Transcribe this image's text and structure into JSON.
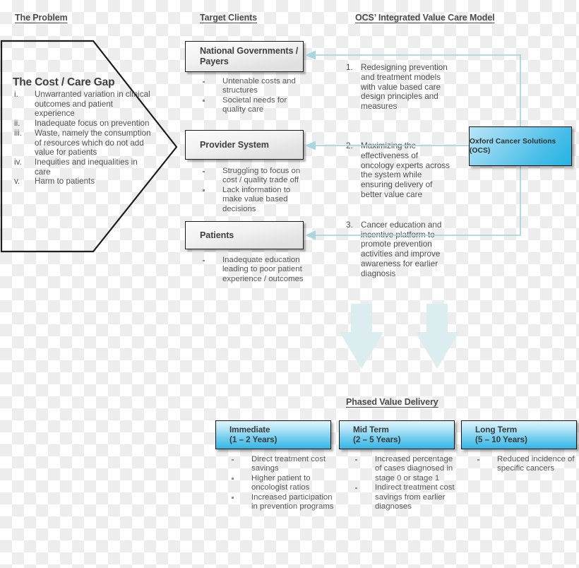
{
  "headers": {
    "problem": "The Problem",
    "target_clients": "Target Clients",
    "ocs_model": "OCS’ Integrated Value Care Model",
    "phased_delivery": "Phased Value Delivery"
  },
  "problem_panel": {
    "title": "The Cost / Care Gap",
    "items": [
      {
        "marker": "i.",
        "text": "Unwarranted variation in clinical outcomes and patient experience"
      },
      {
        "marker": "ii.",
        "text": "Inadequate focus on prevention"
      },
      {
        "marker": "iii.",
        "text": "Waste, namely the consumption of resources which do not add value for patients"
      },
      {
        "marker": "iv.",
        "text": "Inequities and inequalities in care"
      },
      {
        "marker": "v.",
        "text": "Harm to patients"
      }
    ]
  },
  "target_clients": [
    {
      "label": "National Governments / Payers",
      "bullets": [
        "Untenable costs and structures",
        "Societal needs for quality care"
      ]
    },
    {
      "label": "Provider System",
      "bullets": [
        "Struggling to focus on cost / quality trade off",
        "Lack information to make value based decisions"
      ]
    },
    {
      "label": "Patients",
      "bullets": [
        "Inadequate education leading to poor patient experience / outcomes"
      ]
    }
  ],
  "ocs_model": {
    "center_box_label": "Oxford Cancer Solutions (OCS)",
    "points": [
      {
        "marker": "1.",
        "text": "Redesigning prevention and treatment models with value based care design principles and measures"
      },
      {
        "marker": "2.",
        "text": "Maximizing the effectiveness of oncology experts across the system while ensuring delivery of better value care"
      },
      {
        "marker": "3.",
        "text": "Cancer education and incentive platform to promote prevention activities and improve awareness for earlier diagnosis"
      }
    ]
  },
  "phases": [
    {
      "title": "Immediate",
      "period": "(1 – 2 Years)",
      "bullets": [
        "Direct treatment cost savings",
        "Higher patient to oncologist ratios",
        "Increased participation in prevention programs"
      ]
    },
    {
      "title": "Mid Term",
      "period": "(2 – 5 Years)",
      "bullets": [
        "Increased percentage of cases diagnosed in stage 0 or stage 1",
        "Indirect treatment cost savings from earlier diagnoses"
      ]
    },
    {
      "title": "Long Term",
      "period": "(5 – 10 Years)",
      "bullets": [
        "Reduced incidence of specific cancers"
      ]
    }
  ],
  "colors": {
    "connector": "#a9d6de",
    "arrow_fill": "#dceeef",
    "ocs_accent": "#22b3e3",
    "box_border": "#141414",
    "text": "#4e4e4e"
  }
}
